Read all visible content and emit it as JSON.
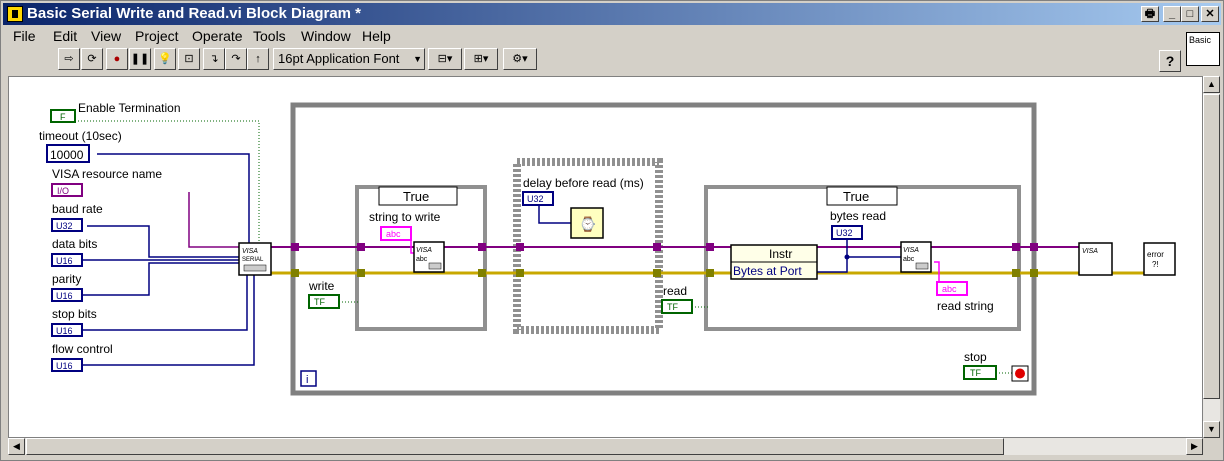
{
  "window": {
    "title": "Basic Serial Write and Read.vi Block Diagram *"
  },
  "title_buttons": {
    "print": "🖶",
    "minimize": "_",
    "restore": "□",
    "close": "✕"
  },
  "menu": [
    "File",
    "Edit",
    "View",
    "Project",
    "Operate",
    "Tools",
    "Window",
    "Help"
  ],
  "toolbar": {
    "font": "16pt Application Font",
    "help": "?"
  },
  "vi_icon": {
    "label": "Basic"
  },
  "diagram": {
    "controls": {
      "enable_termination": "Enable Termination",
      "timeout": "timeout (10sec)",
      "timeout_value": "10000",
      "visa_resource": "VISA resource name",
      "baud_rate": "baud rate",
      "data_bits": "data bits",
      "parity": "parity",
      "stop_bits": "stop bits",
      "flow_control": "flow control",
      "write": "write",
      "read": "read",
      "stop": "stop",
      "string_to_write": "string to write",
      "delay_before_read": "delay before read (ms)",
      "bytes_read": "bytes read",
      "read_string": "read string"
    },
    "types": {
      "u32": "U32",
      "u16": "U16",
      "io": "I/O",
      "tf": "TF",
      "abc": "abc",
      "bool_const": "F"
    },
    "case_selector": "True",
    "property_node": {
      "class": "Instr",
      "property": "Bytes at Port"
    },
    "functions": {
      "visa_serial": "VISA",
      "visa_serial_sub": "SERIAL",
      "visa_write": "VISA",
      "visa_read": "VISA",
      "visa_close": "VISA",
      "error": "error",
      "error_sub": "?!",
      "loop_iter": "i"
    },
    "colors": {
      "wire_visa": "#800080",
      "wire_error": "#c8a800",
      "wire_int": "#000080",
      "wire_bool": "#006400",
      "wire_string": "#ff00ff"
    }
  }
}
